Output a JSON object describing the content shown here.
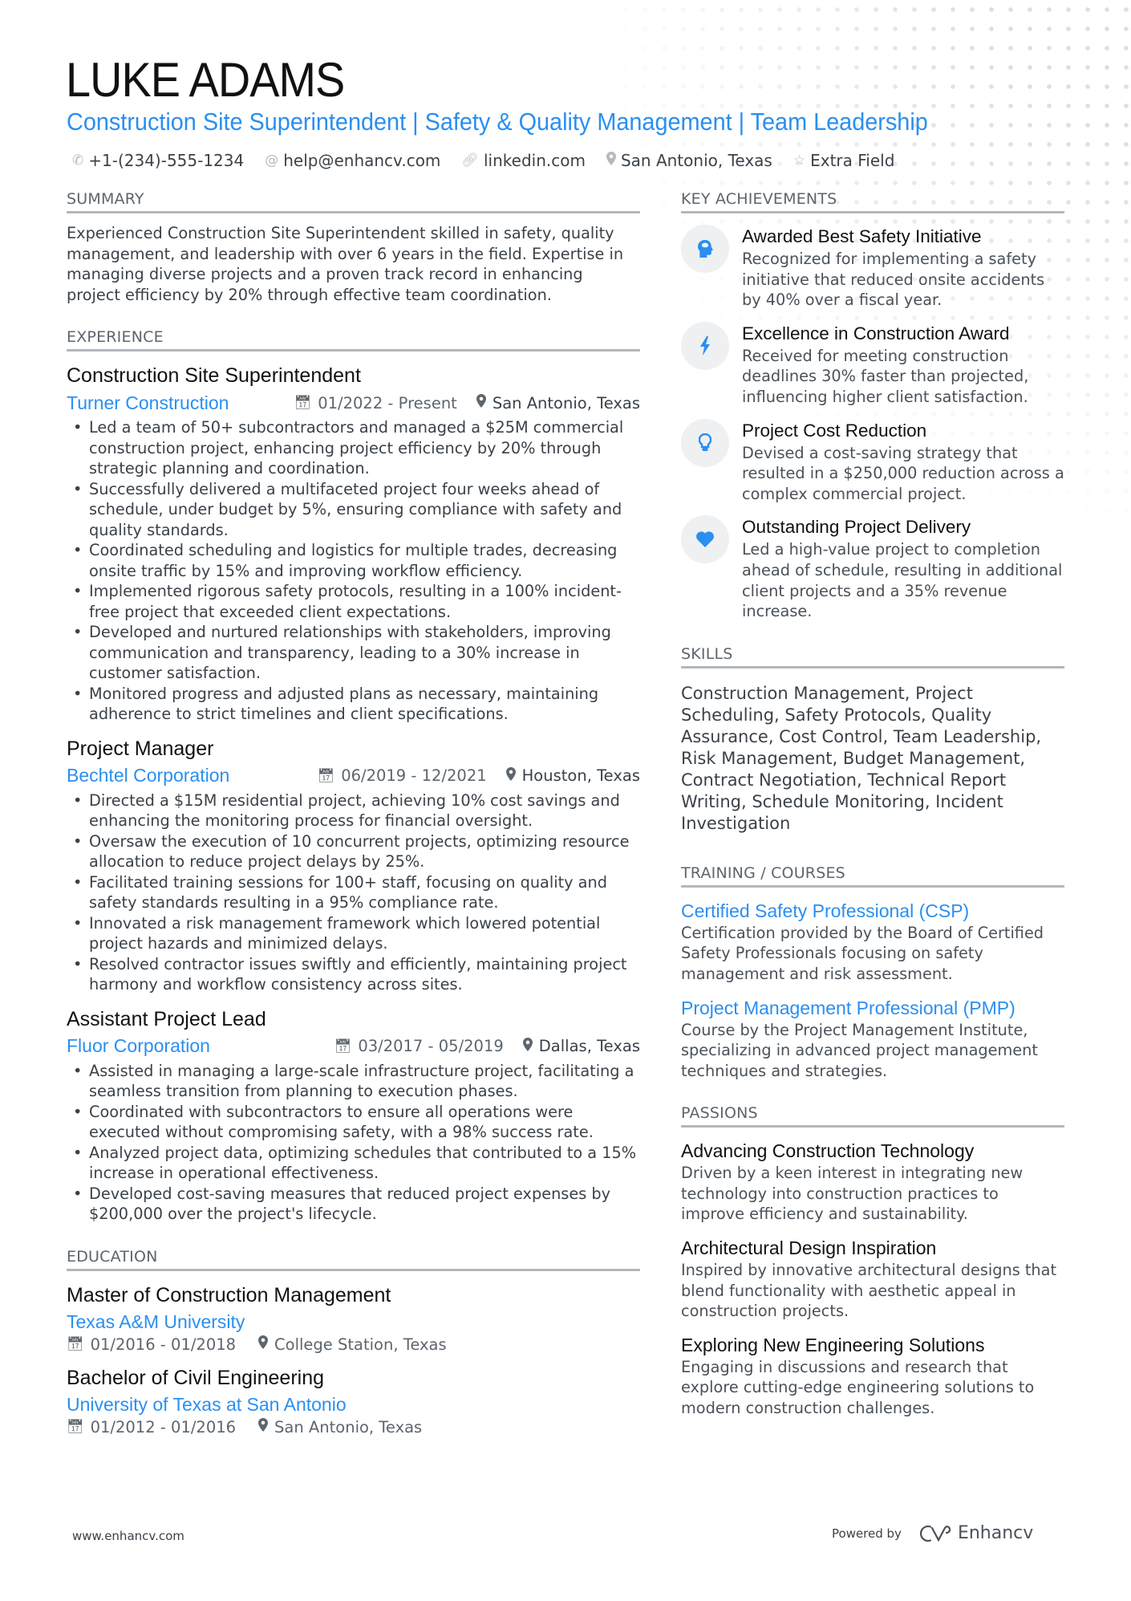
{
  "header": {
    "name": "LUKE ADAMS",
    "headline": "Construction Site Superintendent | Safety & Quality Management | Team Leadership",
    "contacts": [
      {
        "icon": "phone-icon",
        "text": "+1-(234)-555-1234"
      },
      {
        "icon": "at-icon",
        "text": "help@enhancv.com"
      },
      {
        "icon": "link-icon",
        "text": "linkedin.com"
      },
      {
        "icon": "location-icon",
        "text": "San Antonio, Texas"
      },
      {
        "icon": "star-icon",
        "text": "Extra Field"
      }
    ]
  },
  "summary": {
    "title": "SUMMARY",
    "text": "Experienced Construction Site Superintendent skilled in safety, quality management, and leadership with over 6 years in the field. Expertise in managing diverse projects and a proven track record in enhancing project efficiency by 20% through effective team coordination."
  },
  "experience": {
    "title": "EXPERIENCE",
    "jobs": [
      {
        "title": "Construction Site Superintendent",
        "company": "Turner Construction",
        "dates": "01/2022 - Present",
        "location": "San Antonio, Texas",
        "bullets": [
          "Led a team of 50+ subcontractors and managed a $25M commercial construction project, enhancing project efficiency by 20% through strategic planning and coordination.",
          "Successfully delivered a multifaceted project four weeks ahead of schedule, under budget by 5%, ensuring compliance with safety and quality standards.",
          "Coordinated scheduling and logistics for multiple trades, decreasing onsite traffic by 15% and improving workflow efficiency.",
          "Implemented rigorous safety protocols, resulting in a 100% incident-free project that exceeded client expectations.",
          "Developed and nurtured relationships with stakeholders, improving communication and transparency, leading to a 30% increase in customer satisfaction.",
          "Monitored progress and adjusted plans as necessary, maintaining adherence to strict timelines and client specifications."
        ]
      },
      {
        "title": "Project Manager",
        "company": "Bechtel Corporation",
        "dates": "06/2019 - 12/2021",
        "location": "Houston, Texas",
        "bullets": [
          "Directed a $15M residential project, achieving 10% cost savings and enhancing the monitoring process for financial oversight.",
          "Oversaw the execution of 10 concurrent projects, optimizing resource allocation to reduce project delays by 25%.",
          "Facilitated training sessions for 100+ staff, focusing on quality and safety standards resulting in a 95% compliance rate.",
          "Innovated a risk management framework which lowered potential project hazards and minimized delays.",
          "Resolved contractor issues swiftly and efficiently, maintaining project harmony and workflow consistency across sites."
        ]
      },
      {
        "title": "Assistant Project Lead",
        "company": "Fluor Corporation",
        "dates": "03/2017 - 05/2019",
        "location": "Dallas, Texas",
        "bullets": [
          "Assisted in managing a large-scale infrastructure project, facilitating a seamless transition from planning to execution phases.",
          "Coordinated with subcontractors to ensure all operations were executed without compromising safety, with a 98% success rate.",
          "Analyzed project data, optimizing schedules that contributed to a 15% increase in operational effectiveness.",
          "Developed cost-saving measures that reduced project expenses by $200,000 over the project's lifecycle."
        ]
      }
    ]
  },
  "education": {
    "title": "EDUCATION",
    "items": [
      {
        "degree": "Master of Construction Management",
        "school": "Texas A&M University",
        "dates": "01/2016 - 01/2018",
        "location": "College Station, Texas"
      },
      {
        "degree": "Bachelor of Civil Engineering",
        "school": "University of Texas at San Antonio",
        "dates": "01/2012 - 01/2016",
        "location": "San Antonio, Texas"
      }
    ]
  },
  "achievements": {
    "title": "KEY ACHIEVEMENTS",
    "items": [
      {
        "icon": "head-brain-icon",
        "title": "Awarded Best Safety Initiative",
        "desc": "Recognized for implementing a safety initiative that reduced onsite accidents by 40% over a fiscal year."
      },
      {
        "icon": "lightning-bolt-icon",
        "title": "Excellence in Construction Award",
        "desc": "Received for meeting construction deadlines 30% faster than projected, influencing higher client satisfaction."
      },
      {
        "icon": "lightbulb-icon",
        "title": "Project Cost Reduction",
        "desc": "Devised a cost-saving strategy that resulted in a $250,000 reduction across a complex commercial project."
      },
      {
        "icon": "heart-icon",
        "title": "Outstanding Project Delivery",
        "desc": "Led a high-value project to completion ahead of schedule, resulting in additional client projects and a 35% revenue increase."
      }
    ]
  },
  "skills": {
    "title": "SKILLS",
    "text": "Construction Management, Project Scheduling, Safety Protocols, Quality Assurance, Cost Control, Team Leadership, Risk Management, Budget Management, Contract Negotiation, Technical Report Writing, Schedule Monitoring, Incident Investigation"
  },
  "training": {
    "title": "TRAINING / COURSES",
    "items": [
      {
        "title": "Certified Safety Professional (CSP)",
        "desc": "Certification provided by the Board of Certified Safety Professionals focusing on safety management and risk assessment."
      },
      {
        "title": "Project Management Professional (PMP)",
        "desc": "Course by the Project Management Institute, specializing in advanced project management techniques and strategies."
      }
    ]
  },
  "passions": {
    "title": "PASSIONS",
    "items": [
      {
        "title": "Advancing Construction Technology",
        "desc": "Driven by a keen interest in integrating new technology into construction practices to improve efficiency and sustainability."
      },
      {
        "title": "Architectural Design Inspiration",
        "desc": "Inspired by innovative architectural designs that blend functionality with aesthetic appeal in construction projects."
      },
      {
        "title": "Exploring New Engineering Solutions",
        "desc": "Engaging in discussions and research that explore cutting-edge engineering solutions to modern construction challenges."
      }
    ]
  },
  "footer": {
    "website": "www.enhancv.com",
    "powered_by": "Powered by",
    "brand": "Enhancv"
  },
  "colors": {
    "accent": "#2a8ff0",
    "text": "#3a4149",
    "heading": "#111111",
    "divider": "#b3b7bc",
    "icon_bg": "#eef0f2"
  }
}
